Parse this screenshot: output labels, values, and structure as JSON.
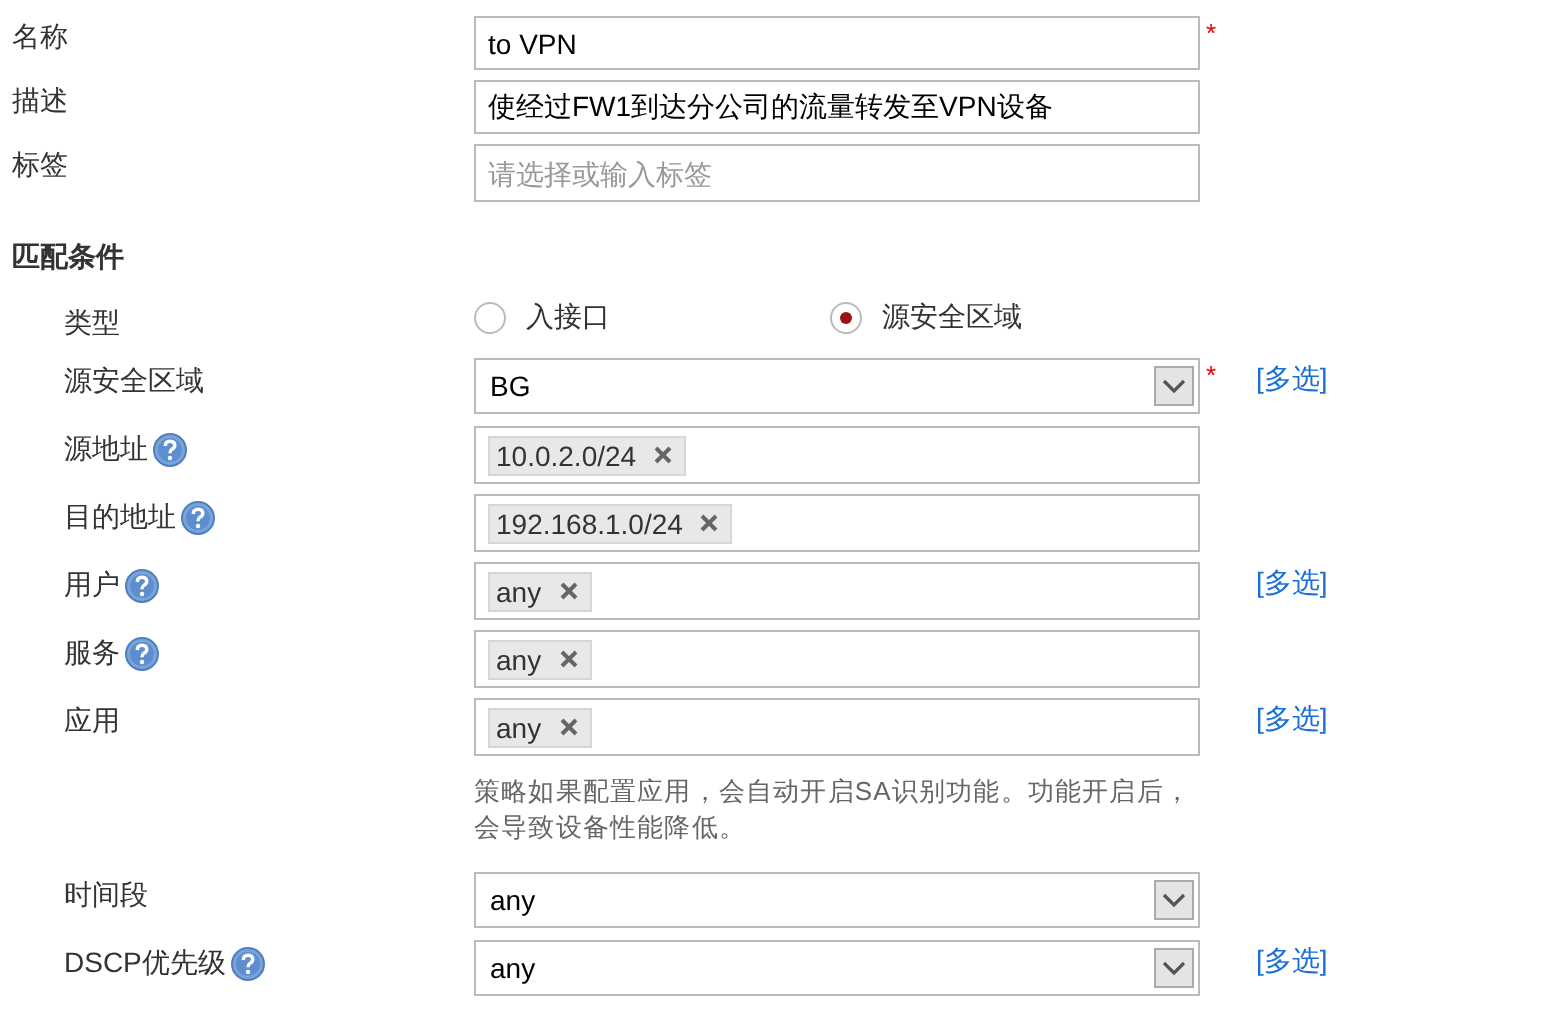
{
  "basic_fields": [
    {
      "kind": "text",
      "label": "名称",
      "value": "to VPN",
      "required_mark": "*"
    },
    {
      "kind": "text",
      "label": "描述",
      "value": "使经过FW1到达分公司的流量转发至VPN设备"
    },
    {
      "kind": "text",
      "label": "标签",
      "placeholder": "请选择或输入标签"
    }
  ],
  "section_title": "匹配条件",
  "match_fields": [
    {
      "kind": "radio",
      "label": "类型",
      "options": [
        {
          "label": "入接口",
          "selected": false
        },
        {
          "label": "源安全区域",
          "selected": true
        }
      ]
    },
    {
      "kind": "select",
      "label": "源安全区域",
      "value": "BG",
      "required_mark": "*",
      "link": "[多选]"
    },
    {
      "kind": "tags",
      "label": "源地址",
      "help": true,
      "tags": [
        "10.0.2.0/24"
      ]
    },
    {
      "kind": "tags",
      "label": "目的地址",
      "help": true,
      "tags": [
        "192.168.1.0/24"
      ]
    },
    {
      "kind": "tags",
      "label": "用户",
      "help": true,
      "tags": [
        "any"
      ],
      "link": "[多选]"
    },
    {
      "kind": "tags",
      "label": "服务",
      "help": true,
      "tags": [
        "any"
      ]
    },
    {
      "kind": "tags",
      "label": "应用",
      "tags": [
        "any"
      ],
      "link": "[多选]",
      "hint": "策略如果配置应用，会自动开启SA识别功能。功能开启后，会导致设备性能降低。"
    },
    {
      "kind": "select",
      "label": "时间段",
      "value": "any"
    },
    {
      "kind": "select",
      "label": "DSCP优先级",
      "help": true,
      "value": "any",
      "link": "[多选]"
    }
  ]
}
